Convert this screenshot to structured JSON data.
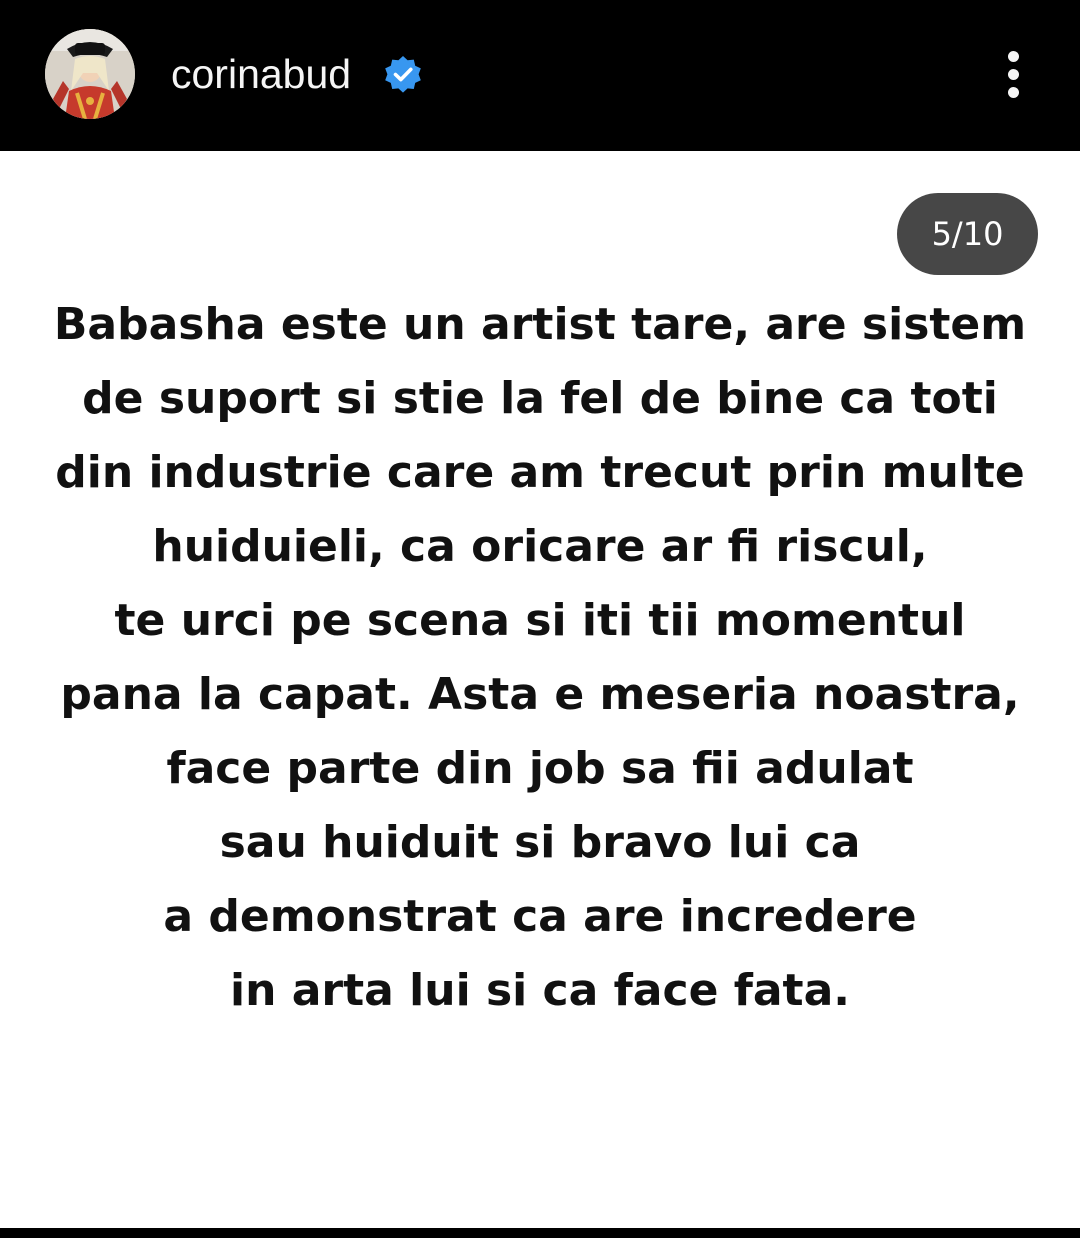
{
  "header": {
    "username": "corinabud",
    "verified": true,
    "avatar_icon": "profile-avatar",
    "more_icon": "vertical-ellipsis-icon",
    "colors": {
      "background": "#000000",
      "verified_badge": "#3897f0"
    }
  },
  "story": {
    "counter": "5/10",
    "lines": [
      "Babasha este un artist tare, are sistem",
      "de suport si stie la fel de bine ca toti",
      "din industrie care am trecut prin multe",
      "huiduieli, ca oricare ar fi riscul,",
      "te urci pe scena si iti tii momentul",
      "pana la capat. Asta e meseria noastra,",
      "face parte din job sa fii adulat",
      "sau huiduit si bravo lui ca",
      "a demonstrat ca are incredere",
      "in arta lui si ca face fata."
    ]
  }
}
